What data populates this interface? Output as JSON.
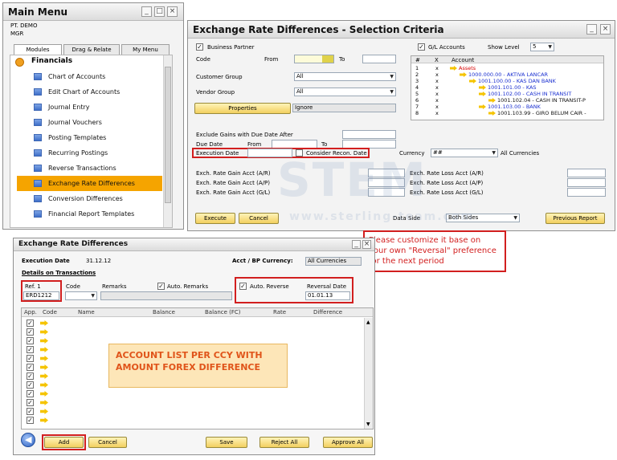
{
  "main_menu": {
    "title": "Main Menu",
    "company": "PT. DEMO",
    "user": "MGR",
    "tabs": [
      "Modules",
      "Drag & Relate",
      "My Menu"
    ],
    "section": "Financials",
    "items": [
      "Chart of Accounts",
      "Edit Chart of Accounts",
      "Journal Entry",
      "Journal Vouchers",
      "Posting Templates",
      "Recurring Postings",
      "Reverse Transactions",
      "Exchange Rate Differences",
      "Conversion Differences",
      "Financial Report Templates"
    ]
  },
  "selection": {
    "title": "Exchange Rate Differences - Selection Criteria",
    "business_partner": "Business Partner",
    "code": "Code",
    "from": "From",
    "to": "To",
    "customer_group": "Customer Group",
    "customer_group_value": "All",
    "vendor_group": "Vendor Group",
    "vendor_group_value": "All",
    "properties": "Properties",
    "ignore": "Ignore",
    "exclude_gains": "Exclude Gains with Due Date After",
    "due_date": "Due Date",
    "due_from": "From",
    "due_to": "To",
    "execution_date": "Execution Date",
    "consider_recon": "Consider Recon. Date",
    "currency": "Currency",
    "currency_value": "##",
    "all_currencies": "All Currencies",
    "gl_accounts": "G/L Accounts",
    "show_level": "Show Level",
    "show_level_value": "5",
    "tree_headers": [
      "#",
      "X",
      "Account"
    ],
    "tree_rows": [
      {
        "n": "1",
        "x": "x",
        "label": "Assets"
      },
      {
        "n": "2",
        "x": "x",
        "label": "1000.000.00 - AKTIVA LANCAR"
      },
      {
        "n": "3",
        "x": "x",
        "label": "1001.100.00 - KAS DAN BANK"
      },
      {
        "n": "4",
        "x": "x",
        "label": "1001.101.00 - KAS"
      },
      {
        "n": "5",
        "x": "x",
        "label": "1001.102.00 - CASH IN TRANSIT"
      },
      {
        "n": "6",
        "x": "x",
        "label": "1001.102.04 - CASH IN TRANSIT-P"
      },
      {
        "n": "7",
        "x": "x",
        "label": "1001.103.00 - BANK"
      },
      {
        "n": "8",
        "x": "x",
        "label": "1001.103.99 - GIRO BELUM CAIR -"
      }
    ],
    "gain_ar": "Exch. Rate Gain Acct (A/R)",
    "gain_ap": "Exch. Rate Gain Acct (A/P)",
    "gain_gl": "Exch. Rate Gain Acct (G/L)",
    "loss_ar": "Exch. Rate Loss Acct (A/R)",
    "loss_ap": "Exch. Rate Loss Acct (A/P)",
    "loss_gl": "Exch. Rate Loss Acct (G/L)",
    "execute": "Execute",
    "cancel": "Cancel",
    "data_side": "Data Side",
    "data_side_value": "Both Sides",
    "previous_report": "Previous Report"
  },
  "callout": "Please customize it base on your own \"Reversal\" preference for the next period",
  "erd": {
    "title": "Exchange Rate Differences",
    "execution_date_label": "Execution Date",
    "execution_date_value": "31.12.12",
    "acct_bp_currency": "Acct / BP Currency:",
    "acct_bp_currency_value": "All Currencies",
    "details": "Details on Transactions",
    "ref1": "Ref. 1",
    "ref1_value": "ERD1212",
    "code": "Code",
    "remarks": "Remarks",
    "auto_remarks": "Auto. Remarks",
    "auto_reverse": "Auto. Reverse",
    "reversal_date": "Reversal Date",
    "reversal_date_value": "01.01.13",
    "columns": [
      "App.",
      "Code",
      "Name",
      "Balance",
      "Balance (FC)",
      "Rate",
      "Difference"
    ],
    "row_count": 12,
    "add": "Add",
    "cancel": "Cancel",
    "save": "Save",
    "reject_all": "Reject All",
    "approve_all": "Approve All"
  },
  "annotation": "ACCOUNT LIST PER CCY WITH AMOUNT FOREX DIFFERENCE",
  "watermark": {
    "brand": "STEM",
    "url": "www.sterling-team.com"
  },
  "colors": {
    "accent": "#f5a400",
    "red": "#d21f1f",
    "button": "#f2cf5f",
    "tree_blue": "#1a2fd0"
  }
}
